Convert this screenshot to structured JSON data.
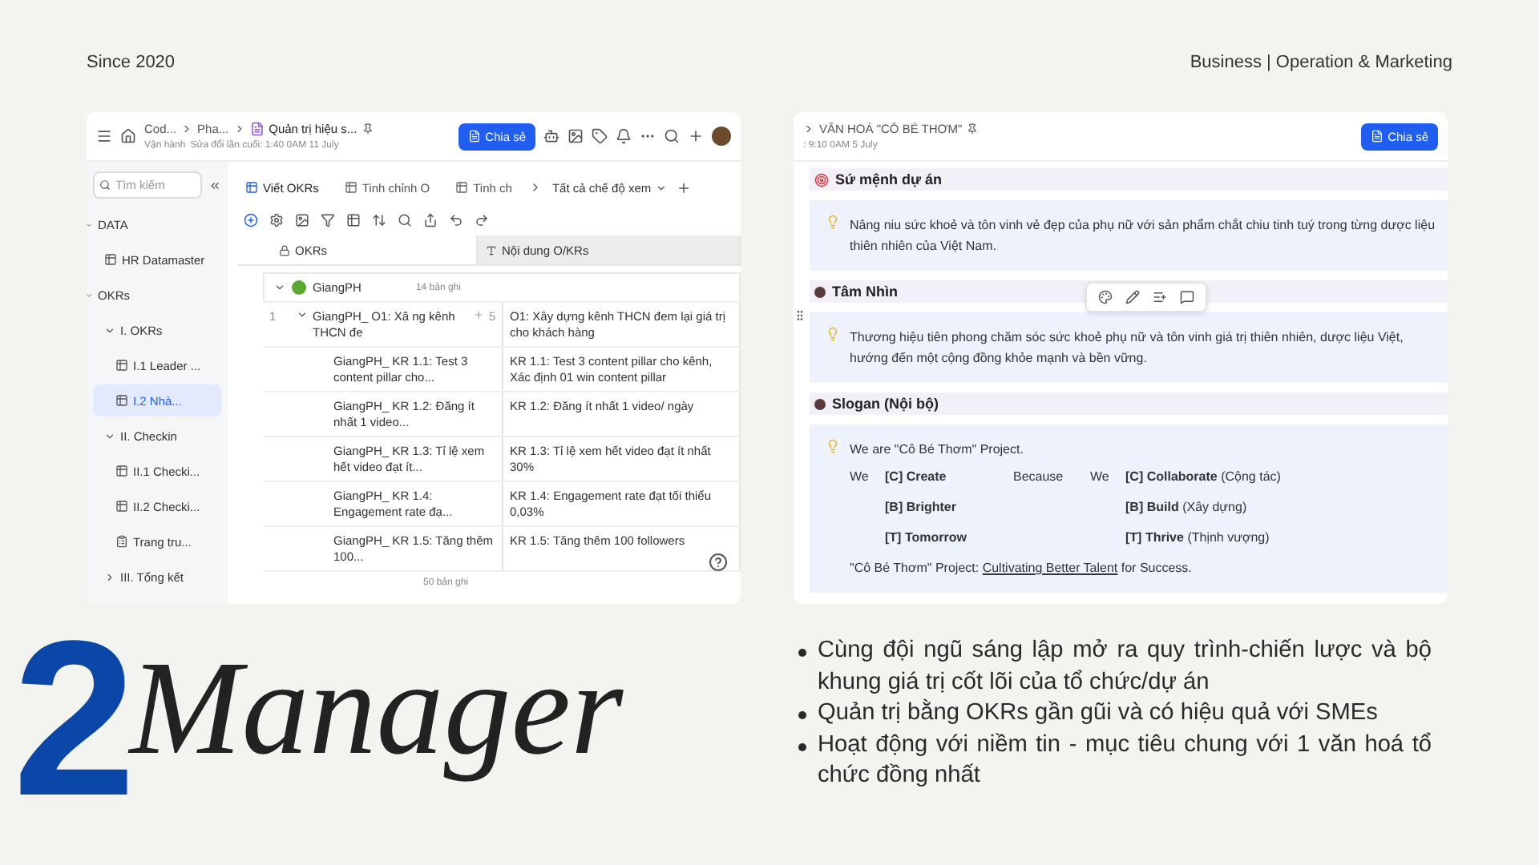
{
  "header": {
    "left": "Since 2020",
    "right": "Business | Operation & Marketing"
  },
  "okr_app": {
    "breadcrumb": [
      "Cod...",
      "Pha...",
      "Quản trị hiệu s..."
    ],
    "workspace": "Vận hành",
    "edited": "Sửa đổi lần cuối: 1:40 0AM 11 July",
    "share_button": "Chia sẻ",
    "sidebar": {
      "search_placeholder": "Tìm kiếm",
      "tree": [
        {
          "label": "DATA",
          "kind": "section",
          "selected": false,
          "children": [
            {
              "label": "HR Datamaster",
              "kind": "table",
              "selected": false
            }
          ]
        },
        {
          "label": "OKRs",
          "kind": "section",
          "selected": false,
          "children": [
            {
              "label": "I. OKRs",
              "kind": "folder",
              "expanded": true,
              "selected": false,
              "children": [
                {
                  "label": "I.1 Leader ...",
                  "kind": "table",
                  "selected": false
                },
                {
                  "label": "I.2 Nhà...",
                  "kind": "table",
                  "selected": true
                }
              ]
            },
            {
              "label": "II. Checkin",
              "kind": "folder",
              "expanded": true,
              "selected": false,
              "children": [
                {
                  "label": "II.1 Checki...",
                  "kind": "table",
                  "selected": false
                },
                {
                  "label": "II.2 Checki...",
                  "kind": "table",
                  "selected": false
                },
                {
                  "label": "Trang tru...",
                  "kind": "form",
                  "selected": false
                }
              ]
            },
            {
              "label": "III. Tổng kết",
              "kind": "folder",
              "expanded": false,
              "selected": false
            }
          ]
        }
      ]
    },
    "tabs": [
      {
        "label": "Viết OKRs",
        "selected": true
      },
      {
        "label": "Tinh chỉnh O",
        "selected": false
      },
      {
        "label": "Tinh ch",
        "selected": false
      }
    ],
    "view_selector": "Tất cả chế độ xem",
    "columns": [
      "OKRs",
      "Nội dung O/KRs"
    ],
    "group": {
      "name": "GiangPH",
      "count": "14 bản ghi",
      "expanded": true
    },
    "rows": [
      {
        "kind": "objective",
        "index": "1",
        "okr": "GiangPH_ O1: Xâ ng kênh THCN đe",
        "subtask_count": "5",
        "content": "O1: Xây dựng kênh THCN đem lại giá trị cho khách hàng"
      },
      {
        "kind": "key_result",
        "okr": "GiangPH_ KR 1.1: Test 3 content pillar cho...",
        "content": "KR 1.1: Test 3 content pillar cho kênh, Xác định 01 win content pillar"
      },
      {
        "kind": "key_result",
        "okr": "GiangPH_ KR 1.2: Đăng ít nhất 1 video...",
        "content": "KR 1.2: Đăng ít nhất 1 video/ ngày"
      },
      {
        "kind": "key_result",
        "okr": "GiangPH_ KR 1.3: Tỉ lệ xem hết video đạt ít...",
        "content": "KR 1.3: Tỉ lệ xem hết video đạt ít nhất 30%"
      },
      {
        "kind": "key_result",
        "okr": "GiangPH_ KR 1.4: Engagement rate đạ...",
        "content": "KR 1.4: Engagement rate đạt tối thiểu 0,03%"
      },
      {
        "kind": "key_result",
        "okr": "GiangPH_ KR 1.5: Tăng thêm 100...",
        "content": "KR 1.5: Tăng thêm 100 followers"
      }
    ],
    "footer_count": "50 bản ghi"
  },
  "culture_doc": {
    "title": "VĂN HOÁ \"CÔ BÉ THƠM\"",
    "edited": ": 9:10 0AM 5 July",
    "share_button": "Chia sẻ",
    "sections": [
      {
        "kind": "target",
        "heading": "Sứ mệnh dự án",
        "text": "Nâng niu sức khoẻ và tôn vinh vẻ đẹp của phụ nữ với sản phẩm chắt chiu tinh tuý trong từng dược liệu thiên nhiên của Việt Nam."
      },
      {
        "kind": "dot",
        "heading": "Tâm Nhìn",
        "text": "Thương hiệu tiên phong chăm sóc sức khoẻ phụ nữ và tôn vinh giá trị thiên nhiên, dược liệu Việt, hướng đến một cộng đồng khỏe mạnh và bền vững."
      },
      {
        "kind": "dot",
        "heading": "Slogan (Nội bộ)",
        "text": "We are \"Cô Bé Thơm\" Project.",
        "slogan_rows": [
          {
            "we": "We",
            "left": "[C] Create",
            "because": "Because",
            "we2": "We",
            "right": "[C] Collaborate",
            "note": "(Cộng tác)"
          },
          {
            "left": "[B] Brighter",
            "right": "[B] Build",
            "note": "(Xây dựng)"
          },
          {
            "left": "[T] Tomorrow",
            "right": "[T] Thrive",
            "note": "(Thịnh vượng)"
          }
        ],
        "closing_prefix": "\"Cô Bé Thơm\" Project: ",
        "closing_link": "Cultivating Better Talent",
        "closing_suffix": " for Success."
      }
    ]
  },
  "title": {
    "number": "2",
    "word": "Manager"
  },
  "bullets": [
    "Cùng đội ngũ sáng lập mở ra quy trình-chiến lược và bộ khung giá trị cốt lõi của tổ chức/dự án",
    "Quản trị bằng OKRs gần gũi và có hiệu quả với SMEs",
    "Hoạt động với niềm tin - mục tiêu chung với 1 văn hoá tổ chức đồng nhất"
  ]
}
